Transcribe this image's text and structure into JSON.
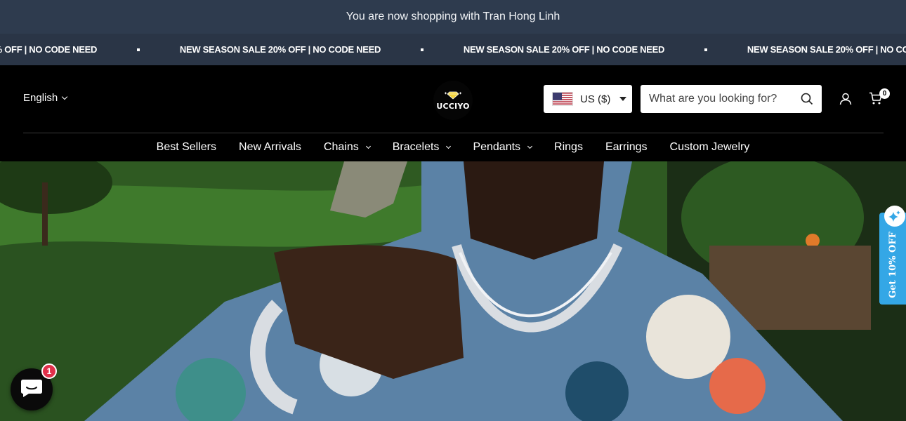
{
  "top_bar": {
    "message": "You are now shopping with Tran Hong Linh"
  },
  "marquee": {
    "items": [
      "NEW SEASON SALE 20% OFF | NO CODE NEED",
      "NEW SEASON SALE 20% OFF | NO CODE NEED",
      "NEW SEASON SALE 20% OFF | NO CODE NEED",
      "NEW SEASON SALE 20% OFF | NO CODE NEED"
    ]
  },
  "header": {
    "language": "English",
    "logo_text": "UCCIYO",
    "currency": {
      "label": "US ($)",
      "flag": "us-flag-icon"
    },
    "search": {
      "placeholder": "What are you looking for?"
    },
    "cart_count": "0"
  },
  "nav": {
    "items": [
      {
        "label": "Best Sellers",
        "has_dropdown": false
      },
      {
        "label": "New Arrivals",
        "has_dropdown": false
      },
      {
        "label": "Chains",
        "has_dropdown": true
      },
      {
        "label": "Bracelets",
        "has_dropdown": true
      },
      {
        "label": "Pendants",
        "has_dropdown": true
      },
      {
        "label": "Rings",
        "has_dropdown": false
      },
      {
        "label": "Earrings",
        "has_dropdown": false
      },
      {
        "label": "Custom Jewelry",
        "has_dropdown": false
      }
    ]
  },
  "discount_tab": {
    "label": "Get 10% OFF"
  },
  "chat": {
    "unread": "1"
  },
  "colors": {
    "top_bar_bg": "#2e3b4e",
    "marquee_bg": "#2a3546",
    "header_bg": "#000000",
    "discount_tab_bg": "#34a7e6",
    "chat_badge_bg": "#e0304a"
  }
}
